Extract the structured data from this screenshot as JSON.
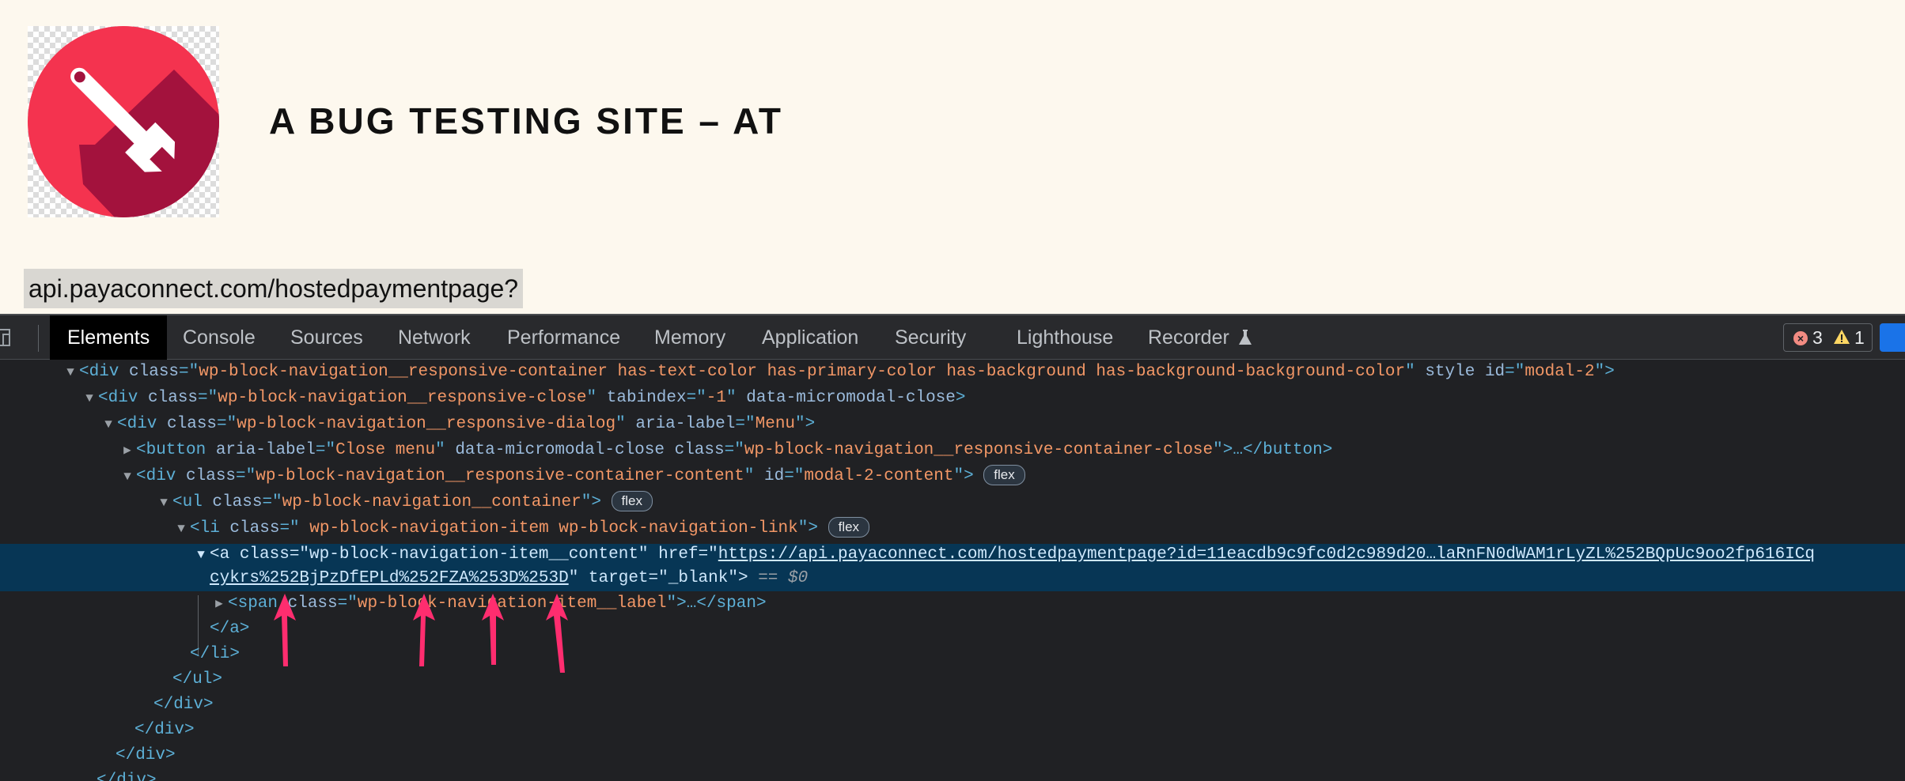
{
  "site": {
    "title": "A BUG TESTING SITE – AT",
    "url_text": "api.payaconnect.com/hostedpaymentpage?",
    "logo_colors": {
      "circle": "#f4334f",
      "shadow": "#a3123d",
      "wrench": "#ffffff"
    }
  },
  "devtools": {
    "tabs": [
      "Elements",
      "Console",
      "Sources",
      "Network",
      "Performance",
      "Memory",
      "Application",
      "Security",
      "Lighthouse",
      "Recorder"
    ],
    "active_tab": "Elements",
    "errors_count": "3",
    "warnings_count": "1",
    "flex_badge": "flex",
    "selected_marker": "== $0",
    "lines": [
      {
        "open": "<div ",
        "attrs": [
          [
            "class",
            "wp-block-navigation__responsive-container  has-text-color has-primary-color has-background has-background-background-color"
          ],
          [
            "style",
            ""
          ],
          [
            "id",
            "modal-2"
          ]
        ],
        "close": ">"
      },
      {
        "open": "<div ",
        "attrs": [
          [
            "class",
            "wp-block-navigation__responsive-close"
          ],
          [
            "tabindex",
            "-1"
          ],
          [
            "data-micromodal-close",
            ""
          ]
        ],
        "close": ">"
      },
      {
        "open": "<div ",
        "attrs": [
          [
            "class",
            "wp-block-navigation__responsive-dialog"
          ],
          [
            "aria-label",
            "Menu"
          ]
        ],
        "close": ">"
      },
      {
        "open": "<button ",
        "attrs": [
          [
            "aria-label",
            "Close menu"
          ],
          [
            "data-micromodal-close",
            ""
          ],
          [
            "class",
            "wp-block-navigation__responsive-container-close"
          ]
        ],
        "close": ">…</button>"
      },
      {
        "open": "<div ",
        "attrs": [
          [
            "class",
            "wp-block-navigation__responsive-container-content"
          ],
          [
            "id",
            "modal-2-content"
          ]
        ],
        "close": ">"
      },
      {
        "open": "<ul ",
        "attrs": [
          [
            "class",
            "wp-block-navigation__container"
          ]
        ],
        "close": ">"
      },
      {
        "open": "<li ",
        "attrs": [
          [
            "class",
            " wp-block-navigation-item wp-block-navigation-link"
          ]
        ],
        "close": ">"
      },
      {
        "open": "<a ",
        "attrs": [
          [
            "class",
            "wp-block-navigation-item__content"
          ]
        ],
        "close": ""
      },
      {
        "href_label": "href",
        "href_part1": "https://api.payaconnect.com/hostedpaymentpage?id=11eacdb9c9fc0d2c989d20…laRnFN0dWAM1rLyZL%252BQpUc9oo2fp616ICq",
        "href_part2": "cykrs%252BjPzDfEPLd%252FZA%253D%253D",
        "target_label": "target",
        "target_value": "_blank"
      },
      {
        "open": "<span ",
        "attrs": [
          [
            "class",
            "wp-block-navigation-item__label"
          ]
        ],
        "close": ">…</span>"
      },
      {
        "text": "</a>"
      },
      {
        "text": "</li>"
      },
      {
        "text": "</ul>"
      },
      {
        "text": "</div>"
      },
      {
        "text": "</div>"
      },
      {
        "text": "</div>"
      },
      {
        "text": "</div>"
      }
    ]
  }
}
